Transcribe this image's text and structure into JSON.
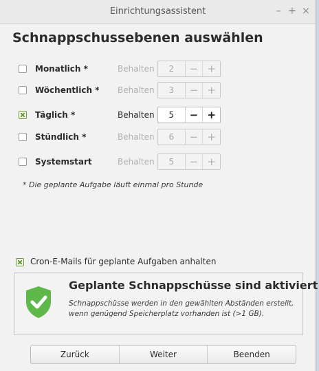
{
  "window": {
    "title": "Einrichtungsassistent",
    "controls": {
      "minimize": "–",
      "maximize": "+",
      "close": "×"
    }
  },
  "heading": "Schnappschussebenen auswählen",
  "levels": [
    {
      "label": "Monatlich *",
      "checked": false,
      "keep_label": "Behalten",
      "value": "2",
      "minus": "−",
      "plus": "+"
    },
    {
      "label": "Wöchentlich *",
      "checked": false,
      "keep_label": "Behalten",
      "value": "3",
      "minus": "−",
      "plus": "+"
    },
    {
      "label": "Täglich *",
      "checked": true,
      "keep_label": "Behalten",
      "value": "5",
      "minus": "−",
      "plus": "+"
    },
    {
      "label": "Stündlich *",
      "checked": false,
      "keep_label": "Behalten",
      "value": "6",
      "minus": "−",
      "plus": "+"
    },
    {
      "label": "Systemstart",
      "checked": false,
      "keep_label": "Behalten",
      "value": "5",
      "minus": "−",
      "plus": "+"
    }
  ],
  "note": "* Die geplante Aufgabe läuft einmal pro Stunde",
  "cron": {
    "label": "Cron-E-Mails für geplante Aufgaben anhalten",
    "checked": true
  },
  "status": {
    "icon": "shield-check-icon",
    "title": "Geplante Schnappschüsse sind aktiviert",
    "text": "Schnappschüsse werden in den gewählten Abständen erstellt, wenn genügend Speicherplatz vorhanden ist (>1 GB).",
    "color": "#5fb84a"
  },
  "buttons": {
    "back": "Zurück",
    "next": "Weiter",
    "finish": "Beenden"
  }
}
